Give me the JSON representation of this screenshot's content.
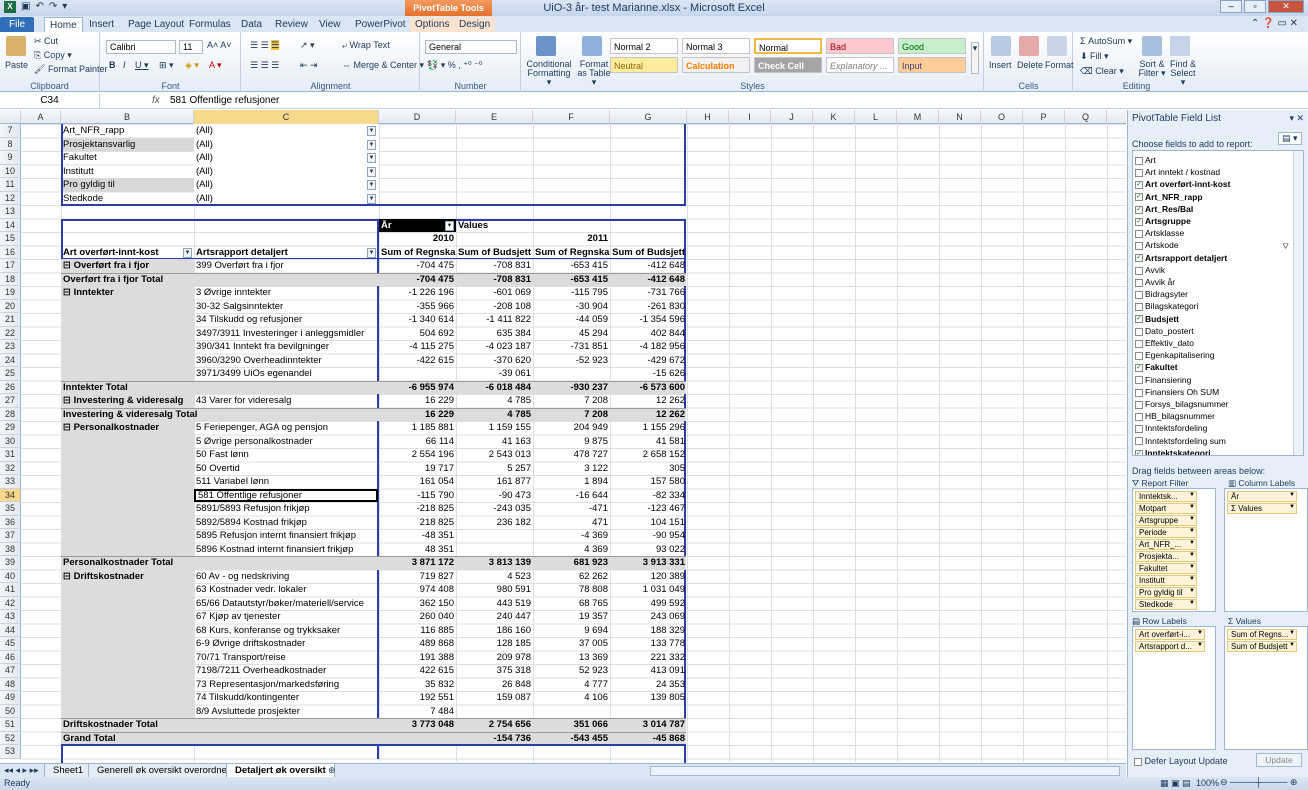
{
  "window": {
    "title": "UiO-3 år- test Marianne.xlsx - Microsoft Excel",
    "context_tab": "PivotTable Tools"
  },
  "tabs": [
    "File",
    "Home",
    "Insert",
    "Page Layout",
    "Formulas",
    "Data",
    "Review",
    "View",
    "PowerPivot",
    "Options",
    "Design"
  ],
  "ribbon": {
    "clipboard": {
      "paste": "Paste",
      "cut": "Cut",
      "copy": "Copy ▾",
      "format_painter": "Format Painter",
      "label": "Clipboard"
    },
    "font": {
      "name": "Calibri",
      "size": "11",
      "label": "Font"
    },
    "alignment": {
      "wrap": "Wrap Text",
      "merge": "Merge & Center ▾",
      "label": "Alignment"
    },
    "number": {
      "format": "General",
      "label": "Number"
    },
    "styles": {
      "conditional": "Conditional Formatting ▾",
      "format_table": "Format as Table ▾",
      "normal2": "Normal 2",
      "normal3": "Normal 3",
      "normal": "Normal",
      "bad": "Bad",
      "good": "Good",
      "neutral": "Neutral",
      "calculation": "Calculation",
      "check_cell": "Check Cell",
      "explanatory": "Explanatory ...",
      "input": "Input",
      "label": "Styles"
    },
    "cells": {
      "insert": "Insert",
      "delete": "Delete",
      "format": "Format",
      "label": "Cells"
    },
    "editing": {
      "autosum": "AutoSum ▾",
      "fill": "Fill ▾",
      "clear": "Clear ▾",
      "sort": "Sort & Filter ▾",
      "find": "Find & Select ▾",
      "label": "Editing"
    }
  },
  "formula_bar": {
    "name_box": "C34",
    "fx": "fx",
    "value": "581 Offentlige refusjoner"
  },
  "columns": [
    "A",
    "B",
    "C",
    "D",
    "E",
    "F",
    "G",
    "H",
    "I",
    "J",
    "K",
    "L",
    "M",
    "N",
    "O",
    "P",
    "Q"
  ],
  "row_numbers": [
    "7",
    "8",
    "9",
    "10",
    "11",
    "12",
    "13",
    "14",
    "15",
    "16",
    "17",
    "18",
    "19",
    "20",
    "21",
    "22",
    "23",
    "24",
    "25",
    "26",
    "27",
    "28",
    "29",
    "30",
    "31",
    "32",
    "33",
    "34",
    "35",
    "36",
    "37",
    "38",
    "39",
    "40",
    "41",
    "42",
    "43",
    "44",
    "45",
    "46",
    "47",
    "48",
    "49",
    "50",
    "51",
    "52",
    "53"
  ],
  "filters": [
    {
      "field": "Art_NFR_rapp",
      "value": "(All)"
    },
    {
      "field": "Prosjektansvarlig",
      "value": "(All)"
    },
    {
      "field": "Fakultet",
      "value": "(All)"
    },
    {
      "field": "Institutt",
      "value": "(All)"
    },
    {
      "field": "Pro gyldig til",
      "value": "(All)"
    },
    {
      "field": "Stedkode",
      "value": "(All)"
    }
  ],
  "pivot_header": {
    "year_field": "År",
    "values_label": "Values",
    "year1": "2010",
    "year2": "2011",
    "row_label1": "Art overført-innt-kost",
    "row_label2": "Artsrapport detaljert",
    "col_headers": [
      "Sum of Regnskap",
      "Sum of Budsjett",
      "Sum of Regnskap",
      "Sum of Budsjett"
    ]
  },
  "rows": [
    {
      "a": "⊟ Overført fra i fjor",
      "b": "399 Overført fra i fjor",
      "v": [
        "-704 475",
        "-708 831",
        "-653 415",
        "-412 648"
      ],
      "t": "d"
    },
    {
      "a": "Overført fra i fjor Total",
      "b": "",
      "v": [
        "-704 475",
        "-708 831",
        "-653 415",
        "-412 648"
      ],
      "t": "t"
    },
    {
      "a": "⊟ Inntekter",
      "b": "3 Øvrige inntekter",
      "v": [
        "-1 226 196",
        "-601 069",
        "-115 795",
        "-731 766"
      ],
      "t": "d"
    },
    {
      "a": "",
      "b": "30-32 Salgsinntekter",
      "v": [
        "-355 966",
        "-208 108",
        "-30 904",
        "-261 830"
      ],
      "t": "d"
    },
    {
      "a": "",
      "b": "34 Tilskudd og refusjoner",
      "v": [
        "-1 340 614",
        "-1 411 822",
        "-44 059",
        "-1 354 596"
      ],
      "t": "d"
    },
    {
      "a": "",
      "b": "3497/3911 Investeringer i anleggsmidler",
      "v": [
        "504 692",
        "635 384",
        "45 294",
        "402 844"
      ],
      "t": "d"
    },
    {
      "a": "",
      "b": "390/341 Inntekt fra bevilgninger",
      "v": [
        "-4 115 275",
        "-4 023 187",
        "-731 851",
        "-4 182 956"
      ],
      "t": "d"
    },
    {
      "a": "",
      "b": "3960/3290 Overheadinntekter",
      "v": [
        "-422 615",
        "-370 620",
        "-52 923",
        "-429 672"
      ],
      "t": "d"
    },
    {
      "a": "",
      "b": "3971/3499 UiOs egenandel",
      "v": [
        "",
        "-39 061",
        "",
        "-15 626"
      ],
      "t": "d"
    },
    {
      "a": "Inntekter Total",
      "b": "",
      "v": [
        "-6 955 974",
        "-6 018 484",
        "-930 237",
        "-6 573 600"
      ],
      "t": "t"
    },
    {
      "a": "⊟ Investering & videresalg",
      "b": "43 Varer for videresalg",
      "v": [
        "16 229",
        "4 785",
        "7 208",
        "12 262"
      ],
      "t": "d"
    },
    {
      "a": "Investering & videresalg Total",
      "b": "",
      "v": [
        "16 229",
        "4 785",
        "7 208",
        "12 262"
      ],
      "t": "t"
    },
    {
      "a": "⊟ Personalkostnader",
      "b": "5 Feriepenger, AGA og pensjon",
      "v": [
        "1 185 881",
        "1 159 155",
        "204 949",
        "1 155 296"
      ],
      "t": "d"
    },
    {
      "a": "",
      "b": "5 Øvrige personalkostnader",
      "v": [
        "66 114",
        "41 163",
        "9 875",
        "41 581"
      ],
      "t": "d"
    },
    {
      "a": "",
      "b": "50 Fast lønn",
      "v": [
        "2 554 196",
        "2 543 013",
        "478 727",
        "2 658 152"
      ],
      "t": "d"
    },
    {
      "a": "",
      "b": "50 Overtid",
      "v": [
        "19 717",
        "5 257",
        "3 122",
        "305"
      ],
      "t": "d"
    },
    {
      "a": "",
      "b": "511 Variabel lønn",
      "v": [
        "161 054",
        "161 877",
        "1 894",
        "157 580"
      ],
      "t": "d"
    },
    {
      "a": "",
      "b": "581 Offentlige refusjoner",
      "v": [
        "-115 790",
        "-90 473",
        "-16 644",
        "-82 334"
      ],
      "t": "d"
    },
    {
      "a": "",
      "b": "5891/5893 Refusjon frikjøp",
      "v": [
        "-218 825",
        "-243 035",
        "-471",
        "-123 467"
      ],
      "t": "d"
    },
    {
      "a": "",
      "b": "5892/5894 Kostnad frikjøp",
      "v": [
        "218 825",
        "236 182",
        "471",
        "104 151"
      ],
      "t": "d"
    },
    {
      "a": "",
      "b": "5895 Refusjon internt finansiert frikjøp",
      "v": [
        "-48 351",
        "",
        "-4 369",
        "-90 954"
      ],
      "t": "d"
    },
    {
      "a": "",
      "b": "5896 Kostnad internt finansiert frikjøp",
      "v": [
        "48 351",
        "",
        "4 369",
        "93 022"
      ],
      "t": "d"
    },
    {
      "a": "Personalkostnader Total",
      "b": "",
      "v": [
        "3 871 172",
        "3 813 139",
        "681 923",
        "3 913 331"
      ],
      "t": "t"
    },
    {
      "a": "⊟ Driftskostnader",
      "b": "60 Av - og nedskriving",
      "v": [
        "719 827",
        "4 523",
        "62 262",
        "120 389"
      ],
      "t": "d"
    },
    {
      "a": "",
      "b": "63 Kostnader vedr. lokaler",
      "v": [
        "974 408",
        "980 591",
        "78 808",
        "1 031 049"
      ],
      "t": "d"
    },
    {
      "a": "",
      "b": "65/66 Datautstyr/bøker/materiell/service",
      "v": [
        "362 150",
        "443 519",
        "68 765",
        "499 592"
      ],
      "t": "d"
    },
    {
      "a": "",
      "b": "67 Kjøp av tjenester",
      "v": [
        "260 040",
        "240 447",
        "19 357",
        "243 069"
      ],
      "t": "d"
    },
    {
      "a": "",
      "b": "68 Kurs, konferanse og trykksaker",
      "v": [
        "116 885",
        "186 160",
        "9 694",
        "188 329"
      ],
      "t": "d"
    },
    {
      "a": "",
      "b": "6-9 Øvrige driftskostnader",
      "v": [
        "489 868",
        "128 185",
        "37 005",
        "133 778"
      ],
      "t": "d"
    },
    {
      "a": "",
      "b": "70/71 Transport/reise",
      "v": [
        "191 388",
        "209 978",
        "13 369",
        "221 332"
      ],
      "t": "d"
    },
    {
      "a": "",
      "b": "7198/7211 Overheadkostnader",
      "v": [
        "422 615",
        "375 318",
        "52 923",
        "413 091"
      ],
      "t": "d"
    },
    {
      "a": "",
      "b": "73 Representasjon/markedsføring",
      "v": [
        "35 832",
        "26 848",
        "4 777",
        "24 353"
      ],
      "t": "d"
    },
    {
      "a": "",
      "b": "74 Tilskudd/kontingenter",
      "v": [
        "192 551",
        "159 087",
        "4 106",
        "139 805"
      ],
      "t": "d"
    },
    {
      "a": "",
      "b": "8/9 Avsluttede prosjekter",
      "v": [
        "7 484",
        "",
        "",
        ""
      ],
      "t": "d"
    },
    {
      "a": "Driftskostnader Total",
      "b": "",
      "v": [
        "3 773 048",
        "",
        "351 066",
        "3 014 787"
      ],
      "t": "t",
      "e": "2 754 656"
    },
    {
      "a": "Grand Total",
      "b": "",
      "v": [
        "",
        "-154 736",
        "-543 455",
        "-45 868"
      ],
      "t": "g"
    }
  ],
  "sheet_tabs": [
    "Sheet1",
    "Generell øk oversikt overordnet",
    "Detaljert øk oversikt"
  ],
  "status": {
    "ready": "Ready",
    "zoom": "100%"
  },
  "field_list": {
    "title": "PivotTable Field List",
    "choose": "Choose fields to add to report:",
    "fields": [
      {
        "n": "Art",
        "c": false
      },
      {
        "n": "Art inntekt / kostnad",
        "c": false
      },
      {
        "n": "Art overført-innt-kost",
        "c": true
      },
      {
        "n": "Art_NFR_rapp",
        "c": true
      },
      {
        "n": "Art_Res/Bal",
        "c": true
      },
      {
        "n": "Artsgruppe",
        "c": true
      },
      {
        "n": "Artsklasse",
        "c": false
      },
      {
        "n": "Artskode",
        "c": false
      },
      {
        "n": "Artsrapport detaljert",
        "c": true
      },
      {
        "n": "Avvik",
        "c": false
      },
      {
        "n": "Avvik år",
        "c": false
      },
      {
        "n": "Bidragsyter",
        "c": false
      },
      {
        "n": "Bilagskategori",
        "c": false
      },
      {
        "n": "Budsjett",
        "c": true
      },
      {
        "n": "Dato_postert",
        "c": false
      },
      {
        "n": "Effektiv_dato",
        "c": false
      },
      {
        "n": "Egenkapitalisering",
        "c": false
      },
      {
        "n": "Fakultet",
        "c": true
      },
      {
        "n": "Finansiering",
        "c": false
      },
      {
        "n": "Finansiers Oh SUM",
        "c": false
      },
      {
        "n": "Forsys_bilagsnummer",
        "c": false
      },
      {
        "n": "HB_bilagsnummer",
        "c": false
      },
      {
        "n": "Inntektsfordeling",
        "c": false
      },
      {
        "n": "Inntektsfordeling sum",
        "c": false
      },
      {
        "n": "Inntektskategori",
        "c": true
      }
    ],
    "drag_label": "Drag fields between areas below:",
    "report_filter_label": "Report Filter",
    "column_labels_label": "Column Labels",
    "row_labels_label": "Row Labels",
    "values_label": "Values",
    "report_filters": [
      "Inntektsk...",
      "Motpart",
      "Artsgruppe",
      "Periode",
      "Art_NFR_...",
      "Prosjekta...",
      "Fakultet",
      "Institutt",
      "Pro gyldig til",
      "Stedkode"
    ],
    "column_items": [
      "År",
      "Σ Values"
    ],
    "row_items": [
      "Art overført-i...",
      "Artsrapport d..."
    ],
    "value_items": [
      "Sum of Regns...",
      "Sum of Budsjett"
    ],
    "defer": "Defer Layout Update",
    "update": "Update"
  }
}
